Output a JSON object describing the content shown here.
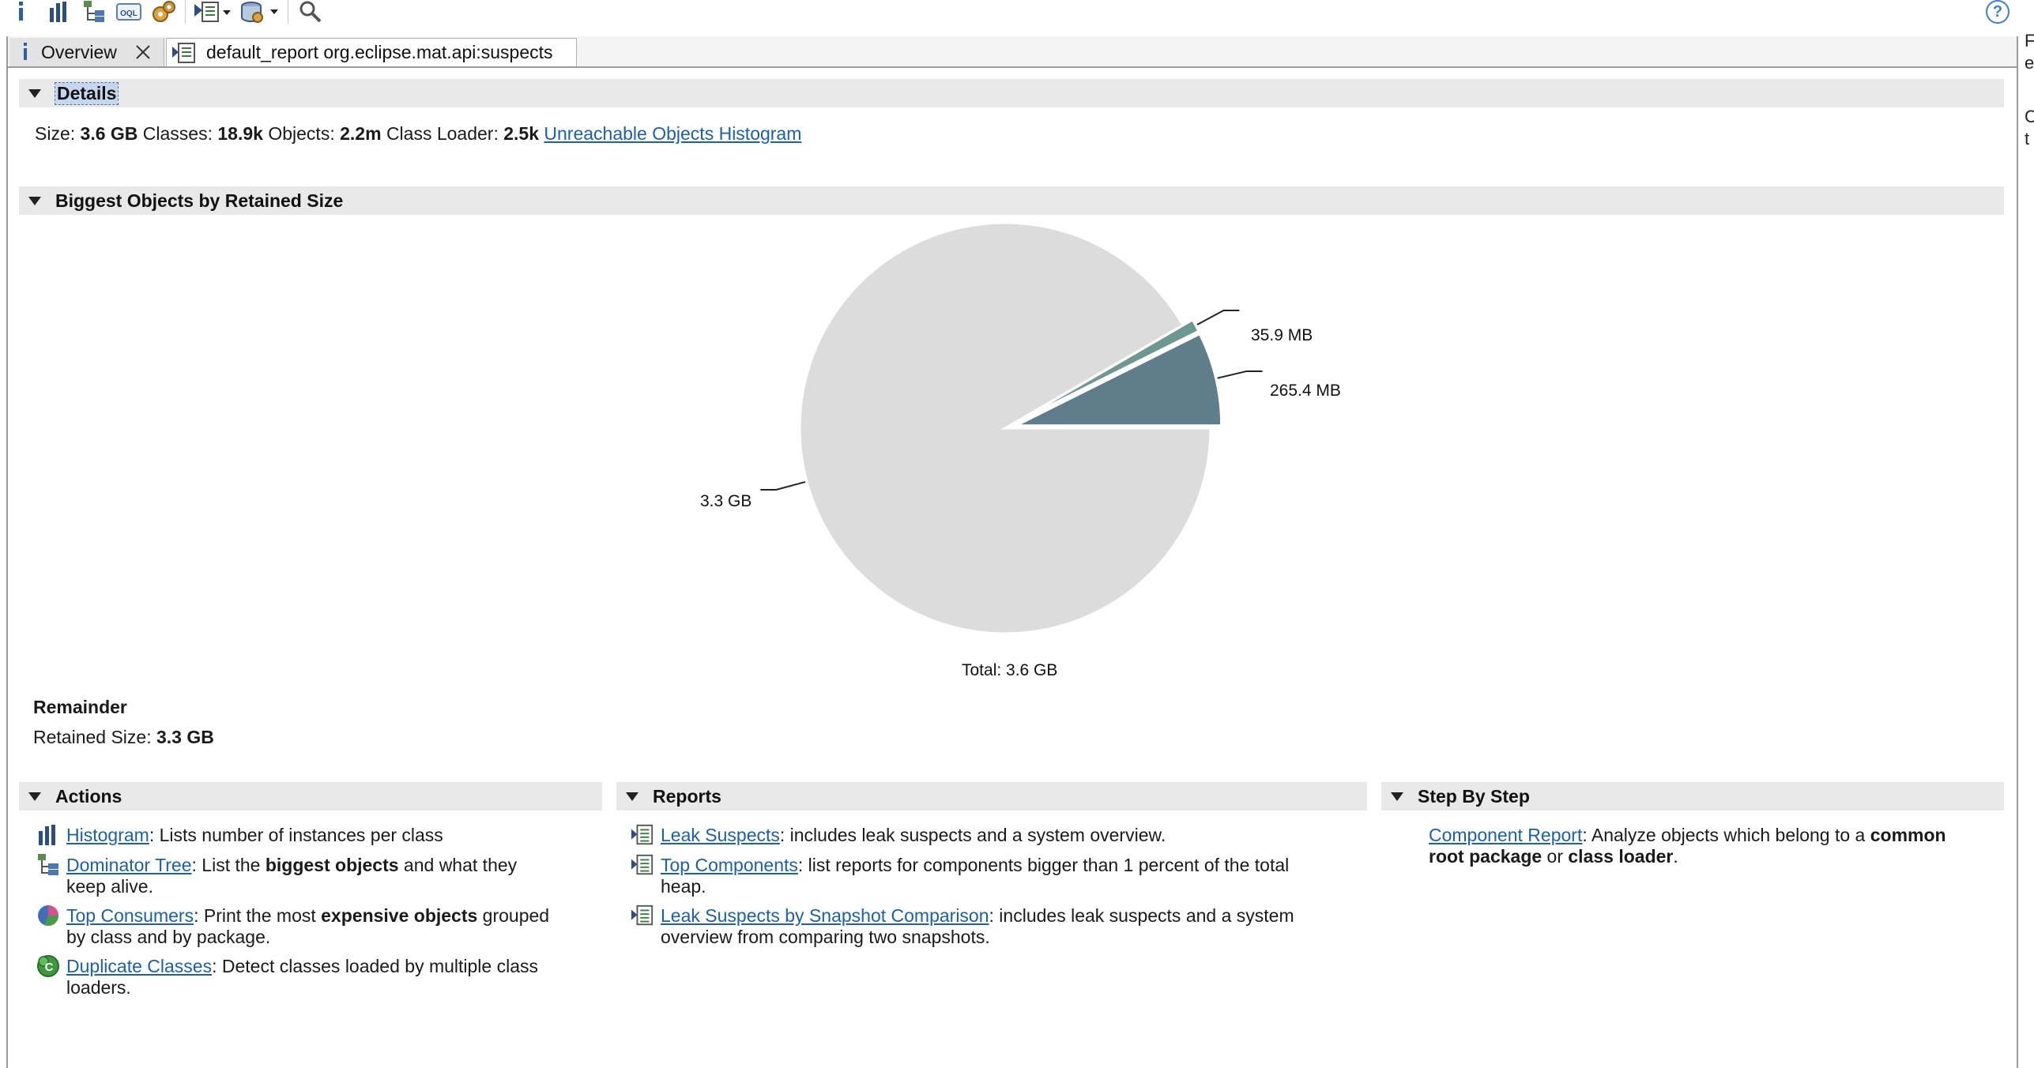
{
  "toolbar": {
    "icons": [
      "info-icon",
      "histogram-icon",
      "dominator-tree-icon",
      "oql-icon",
      "thread-gears-icon",
      "run-report-icon",
      "query-browser-icon",
      "search-icon"
    ],
    "oql_text": "OQL",
    "help": "?"
  },
  "tabs": [
    {
      "label": "Overview",
      "icon": "info-icon",
      "active": true
    },
    {
      "label": "default_report org.eclipse.mat.api:suspects",
      "icon": "report-icon",
      "active": false
    }
  ],
  "details": {
    "title": "Details",
    "size_label": "Size:",
    "size_value": "3.6 GB",
    "classes_label": "Classes:",
    "classes_value": "18.9k",
    "objects_label": "Objects:",
    "objects_value": "2.2m",
    "loader_label": "Class Loader:",
    "loader_value": "2.5k",
    "unreachable_link": "Unreachable Objects Histogram"
  },
  "biggest": {
    "title": "Biggest Objects by Retained Size",
    "total_label": "Total: 3.6 GB",
    "remainder_title": "Remainder",
    "retained_label": "Retained Size:",
    "retained_value": "3.3 GB"
  },
  "chart_data": {
    "type": "pie",
    "slices": [
      {
        "label": "265.4 MB",
        "value": 265.4,
        "color": "#607d8b"
      },
      {
        "label": "35.9 MB",
        "value": 35.9,
        "color": "#6f9690"
      },
      {
        "label": "3.3 GB",
        "value": 3300,
        "color": "#dcdcdc"
      }
    ],
    "total": "Total: 3.6 GB"
  },
  "actions": {
    "title": "Actions",
    "items": [
      {
        "link": "Histogram",
        "pre": ": Lists number of instances per class",
        "bold": "",
        "post": "",
        "line2": "",
        "icon": "histogram-icon"
      },
      {
        "link": "Dominator Tree",
        "pre": ": List the ",
        "bold": "biggest objects",
        "post": " and what they",
        "line2": "keep alive.",
        "icon": "dominator-tree-icon"
      },
      {
        "link": "Top Consumers",
        "pre": ": Print the most ",
        "bold": "expensive objects",
        "post": " grouped",
        "line2": "by class and by package.",
        "icon": "top-consumers-icon"
      },
      {
        "link": "Duplicate Classes",
        "pre": ": Detect classes loaded by multiple class",
        "bold": "",
        "post": "",
        "line2": "loaders.",
        "icon": "duplicate-classes-icon"
      }
    ]
  },
  "reports": {
    "title": "Reports",
    "items": [
      {
        "link": "Leak Suspects",
        "text": ": includes leak suspects and a system overview.",
        "line2": "",
        "icon": "report-icon"
      },
      {
        "link": "Top Components",
        "text": ": list reports for components bigger than 1 percent of the total",
        "line2": "heap.",
        "icon": "report-icon"
      },
      {
        "link": "Leak Suspects by Snapshot Comparison",
        "text": ": includes leak suspects and a system",
        "line2": "overview from comparing two snapshots.",
        "icon": "report-icon"
      }
    ]
  },
  "stepbystep": {
    "title": "Step By Step",
    "link": "Component Report",
    "pre": ": Analyze objects which belong to a ",
    "bold1": "common",
    "bold2": "root package",
    "mid": " or ",
    "bold3": "class loader",
    "end": "."
  },
  "right_strip": [
    "F",
    "e",
    "",
    "C",
    "t"
  ]
}
